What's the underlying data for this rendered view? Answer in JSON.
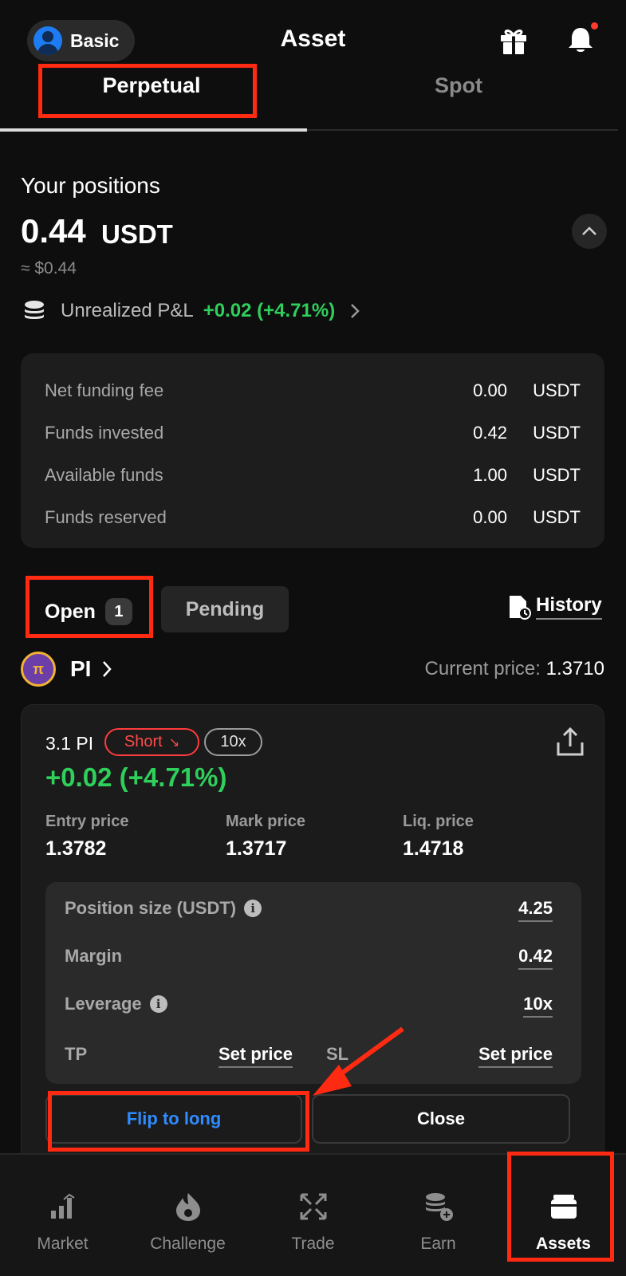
{
  "header": {
    "account_label": "Basic",
    "title": "Asset"
  },
  "tabs": [
    {
      "label": "Perpetual",
      "active": true
    },
    {
      "label": "Spot",
      "active": false
    }
  ],
  "positions": {
    "title": "Your positions",
    "value": "0.44",
    "unit": "USDT",
    "usd_equiv": "≈ $0.44",
    "pnl_label": "Unrealized P&L",
    "pnl_value": "+0.02 (+4.71%)"
  },
  "summary": [
    {
      "label": "Net funding fee",
      "value": "0.00",
      "unit": "USDT"
    },
    {
      "label": "Funds invested",
      "value": "0.42",
      "unit": "USDT"
    },
    {
      "label": "Available funds",
      "value": "1.00",
      "unit": "USDT"
    },
    {
      "label": "Funds reserved",
      "value": "0.00",
      "unit": "USDT"
    }
  ],
  "filters": {
    "open_label": "Open",
    "open_count": "1",
    "pending_label": "Pending",
    "history_label": "History"
  },
  "instrument": {
    "symbol": "PI",
    "logo_text": "π",
    "current_price_label": "Current price:",
    "current_price": "1.3710"
  },
  "position_card": {
    "quantity": "3.1 PI",
    "side": "Short",
    "side_arrow": "↘",
    "leverage_tag": "10x",
    "pnl": "+0.02 (+4.71%)",
    "entry_label": "Entry price",
    "entry_value": "1.3782",
    "mark_label": "Mark price",
    "mark_value": "1.3717",
    "liq_label": "Liq. price",
    "liq_value": "1.4718",
    "size_label": "Position size (USDT)",
    "size_value": "4.25",
    "margin_label": "Margin",
    "margin_value": "0.42",
    "leverage_label": "Leverage",
    "leverage_value": "10x",
    "tp_label": "TP",
    "tp_action": "Set price",
    "sl_label": "SL",
    "sl_action": "Set price",
    "flip_label": "Flip to long",
    "close_label": "Close"
  },
  "bottom_nav": [
    {
      "label": "Market",
      "icon": "bar-chart-icon"
    },
    {
      "label": "Challenge",
      "icon": "flame-icon"
    },
    {
      "label": "Trade",
      "icon": "arrows-exchange-icon"
    },
    {
      "label": "Earn",
      "icon": "coins-plus-icon"
    },
    {
      "label": "Assets",
      "icon": "wallet-icon",
      "active": true
    }
  ],
  "colors": {
    "background": "#0e0e0e",
    "positive": "#2fcf5b",
    "negative": "#ff3b3b",
    "accent_blue": "#2f8cff",
    "annotation_red": "#ff2a12"
  }
}
